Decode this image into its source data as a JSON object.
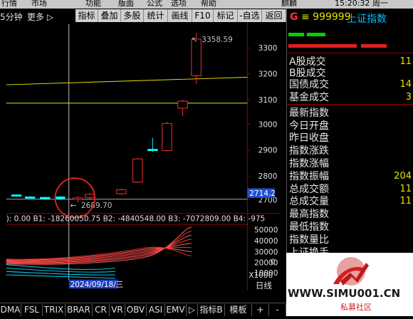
{
  "topbar": {
    "items": [
      "行情",
      "市场",
      "功能",
      "版面",
      "公式",
      "选项",
      "帮助",
      "麒麟",
      "15:20:32 周一"
    ]
  },
  "toolbar": {
    "period": "5分钟",
    "more": "更多 ▷",
    "buttons": [
      "指标",
      "叠加",
      "多股",
      "统计",
      "画线",
      "F10",
      "标记",
      "-自选",
      "返回"
    ]
  },
  "chart": {
    "price_ticks": [
      "3300",
      "3200",
      "3100",
      "3000",
      "2900",
      "2800",
      "2700"
    ],
    "high_label": "3358.59",
    "low_label": "2689.70",
    "current_price": "2714.2",
    "volume_ticks": [
      "50000",
      "40000",
      "30000",
      "20000",
      "10000",
      "0",
      "X1000"
    ],
    "indicator_line": "): 0.00  B1: -18260050.75  B2: -4840548.00  B3: -7072809.00  B4: -975",
    "date_label": "2024/09/18/三",
    "period_label": "日线",
    "colors": {
      "up": "#ff3030",
      "down": "#00ffff",
      "yellow_line": "#e8e000",
      "crosshair": "#c0c0c0"
    },
    "candles": [
      {
        "o": 2716,
        "c": 2720,
        "h": 2722,
        "l": 2712,
        "dir": "down"
      },
      {
        "o": 2712,
        "c": 2710,
        "h": 2715,
        "l": 2706,
        "dir": "down"
      },
      {
        "o": 2708,
        "c": 2710,
        "h": 2713,
        "l": 2704,
        "dir": "down"
      },
      {
        "o": 2712,
        "c": 2704,
        "h": 2714,
        "l": 2700,
        "dir": "down"
      },
      {
        "o": 2702,
        "c": 2708,
        "h": 2716,
        "l": 2690,
        "dir": "up"
      },
      {
        "o": 2710,
        "c": 2722,
        "h": 2728,
        "l": 2704,
        "dir": "up"
      },
      {
        "o": 2724,
        "c": 2740,
        "h": 2746,
        "l": 2720,
        "dir": "up"
      },
      {
        "o": 2770,
        "c": 2862,
        "h": 2866,
        "l": 2766,
        "dir": "up"
      },
      {
        "o": 2896,
        "c": 2900,
        "h": 2945,
        "l": 2890,
        "dir": "down"
      },
      {
        "o": 2895,
        "c": 3002,
        "h": 3008,
        "l": 2892,
        "dir": "up"
      },
      {
        "o": 3062,
        "c": 3090,
        "h": 3096,
        "l": 3030,
        "dir": "up"
      },
      {
        "o": 3190,
        "c": 3335,
        "h": 3358.59,
        "l": 3158,
        "dir": "up"
      }
    ]
  },
  "bottombar": {
    "tabs": [
      "DMA",
      "FSL",
      "TRIX",
      "BRAR",
      "CR",
      "VR",
      "OBV",
      "ASI",
      "EMV",
      "▷",
      "指标B",
      "模板",
      "+",
      "-"
    ]
  },
  "panel": {
    "header_letter": "G",
    "header_code": "≡ 999999",
    "header_name": "上证指数",
    "rows": [
      {
        "label": "A股成交",
        "value": "11"
      },
      {
        "label": "B股成交",
        "value": ""
      },
      {
        "label": "国债成交",
        "value": "14"
      },
      {
        "label": "基金成交",
        "value": "3"
      },
      {
        "label": "最新指数",
        "value": ""
      },
      {
        "label": "今日开盘",
        "value": ""
      },
      {
        "label": "昨日收盘",
        "value": ""
      },
      {
        "label": "指数涨跌",
        "value": ""
      },
      {
        "label": "指数涨幅",
        "value": ""
      },
      {
        "label": "指数振幅",
        "value": "204"
      },
      {
        "label": "总成交额",
        "value": "11"
      },
      {
        "label": "总成交量",
        "value": "11"
      },
      {
        "label": "最高指数",
        "value": ""
      },
      {
        "label": "最低指数",
        "value": ""
      },
      {
        "label": "指数量比",
        "value": ""
      },
      {
        "label": "上证换手",
        "value": ""
      }
    ]
  },
  "watermark": {
    "site": "WWW.SIMU001.CN",
    "caption": "私募社区"
  }
}
